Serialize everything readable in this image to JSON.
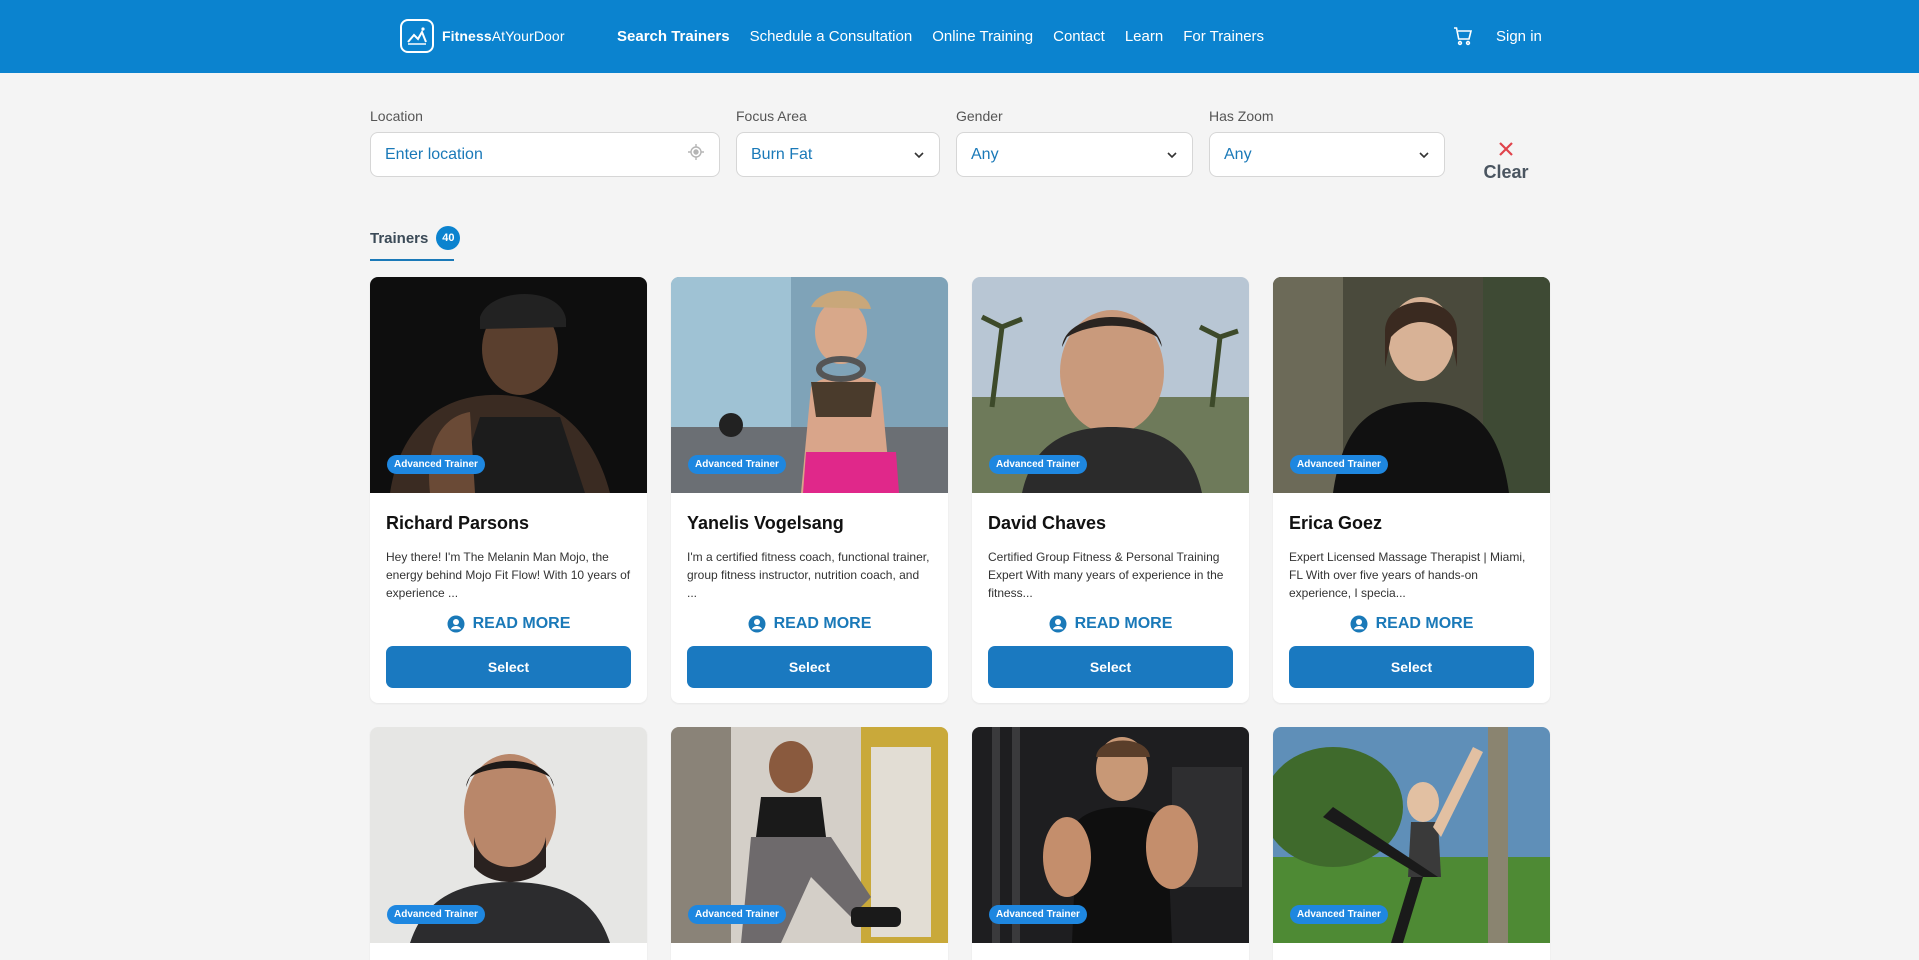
{
  "header": {
    "brand_bold": "Fitness",
    "brand_rest": "AtYourDoor",
    "nav": [
      "Search Trainers",
      "Schedule a Consultation",
      "Online Training",
      "Contact",
      "Learn",
      "For Trainers"
    ],
    "signin": "Sign in",
    "cart_icon": "cart-icon"
  },
  "filters": {
    "location": {
      "label": "Location",
      "placeholder": "Enter location",
      "icon": "locate-icon"
    },
    "focus": {
      "label": "Focus Area",
      "value": "Burn Fat"
    },
    "gender": {
      "label": "Gender",
      "value": "Any"
    },
    "zoom": {
      "label": "Has Zoom",
      "value": "Any"
    },
    "clear": "Clear"
  },
  "tab": {
    "label": "Trainers",
    "count": "40"
  },
  "cards_row1": [
    {
      "badge": "Advanced Trainer",
      "name": "Richard Parsons",
      "bio": "Hey there! I'm The Melanin Man Mojo, the energy behind Mojo Fit Flow! With 10 years of experience ...",
      "read_more": "READ MORE",
      "select": "Select"
    },
    {
      "badge": "Advanced Trainer",
      "name": "Yanelis Vogelsang",
      "bio": "I'm a certified fitness coach, functional trainer, group fitness instructor, nutrition coach, and ...",
      "read_more": "READ MORE",
      "select": "Select"
    },
    {
      "badge": "Advanced Trainer",
      "name": "David Chaves",
      "bio": "Certified Group Fitness & Personal Training Expert With many years of experience in the fitness...",
      "read_more": "READ MORE",
      "select": "Select"
    },
    {
      "badge": "Advanced Trainer",
      "name": "Erica Goez",
      "bio": "Expert Licensed Massage Therapist | Miami, FL With over five years of hands-on experience, I specia...",
      "read_more": "READ MORE",
      "select": "Select"
    }
  ],
  "cards_row2": [
    {
      "badge": "Advanced Trainer"
    },
    {
      "badge": "Advanced Trainer"
    },
    {
      "badge": "Advanced Trainer"
    },
    {
      "badge": "Advanced Trainer"
    }
  ],
  "colors": {
    "primary": "#0b83cf",
    "button": "#1a79c0",
    "badge": "#1e87e0",
    "clear_x": "#e0434b"
  }
}
